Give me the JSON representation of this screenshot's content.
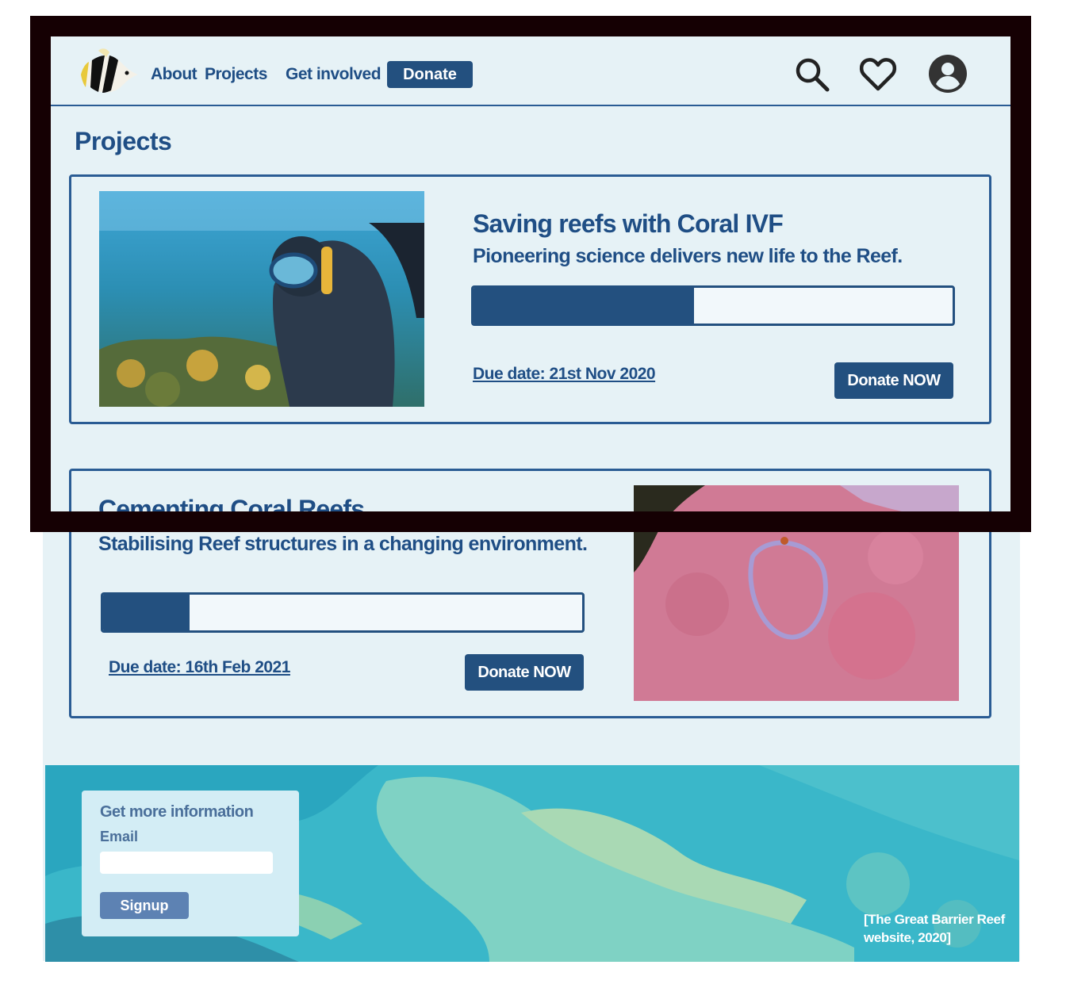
{
  "nav": {
    "about": "About",
    "projects": "Projects",
    "get_involved": "Get involved",
    "donate": "Donate",
    "icons": [
      "search-icon",
      "heart-icon",
      "account-icon"
    ]
  },
  "page_title": "Projects",
  "projects": [
    {
      "title": "Saving reefs with Coral IVF",
      "subtitle": "Pioneering science delivers new life to the Reef.",
      "progress": 0.46,
      "due": "Due date: 21st Nov 2020",
      "donate": "Donate NOW"
    },
    {
      "title": "Cementing Coral Reefs",
      "subtitle": "Stabilising Reef structures in a changing environment.",
      "progress": 0.18,
      "due": "Due date: 16th Feb 2021",
      "donate": "Donate NOW"
    }
  ],
  "signup": {
    "heading": "Get more information",
    "email_label": "Email",
    "email_value": "",
    "button": "Signup"
  },
  "credit": "[The Great Barrier Reef\nwebsite, 2020]",
  "colors": {
    "brand": "#23507f",
    "text": "#1f4e85",
    "page_bg": "#e6f2f6",
    "frame": "#150003"
  }
}
